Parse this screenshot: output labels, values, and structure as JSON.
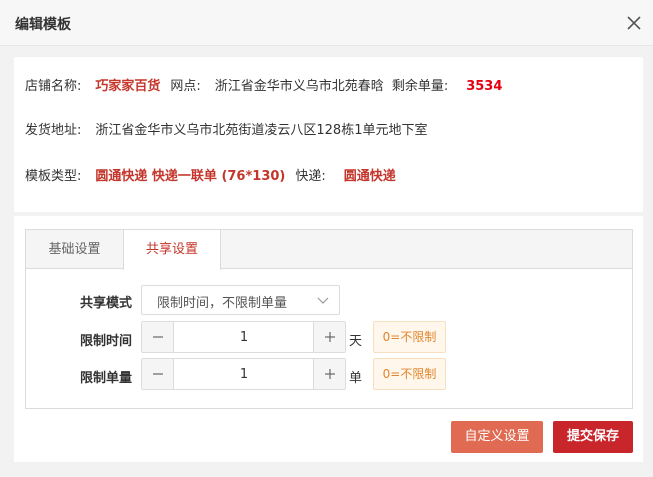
{
  "dialog": {
    "title": "编辑模板"
  },
  "info": {
    "shop_label": "店铺名称:",
    "shop_name": "巧家家百货",
    "outlet_label": "网点:",
    "outlet_value": "浙江省金华市义乌市北苑春晗",
    "remaining_label": "剩余单量:",
    "remaining_value": "3534",
    "address_label": "发货地址:",
    "address_value": "浙江省金华市义乌市北苑街道凌云八区128栋1单元地下室",
    "template_type_label": "模板类型:",
    "template_type_value": "圆通快递 快递一联单 (76*130)",
    "express_label": "快递:",
    "express_value": "圆通快递"
  },
  "tabs": [
    {
      "label": "基础设置",
      "active": false
    },
    {
      "label": "共享设置",
      "active": true
    }
  ],
  "share_form": {
    "mode_label": "共享模式",
    "mode_value": "限制时间，不限制单量",
    "time_label": "限制时间",
    "time_value": "1",
    "time_unit": "天",
    "time_hint": "0=不限制",
    "count_label": "限制单量",
    "count_value": "1",
    "count_unit": "单",
    "count_hint": "0=不限制"
  },
  "buttons": {
    "custom_label": "自定义设置",
    "save_label": "提交保存"
  },
  "icons": {
    "close": "close-icon",
    "select_arrow": "chevron-down-icon",
    "minus": "minus-icon",
    "plus": "plus-icon"
  },
  "colors": {
    "accent": "#c4362b",
    "highlight": "#e60012",
    "hint_text": "#e0862e",
    "custom_button": "#e06a52",
    "save_button": "#c8262b"
  }
}
